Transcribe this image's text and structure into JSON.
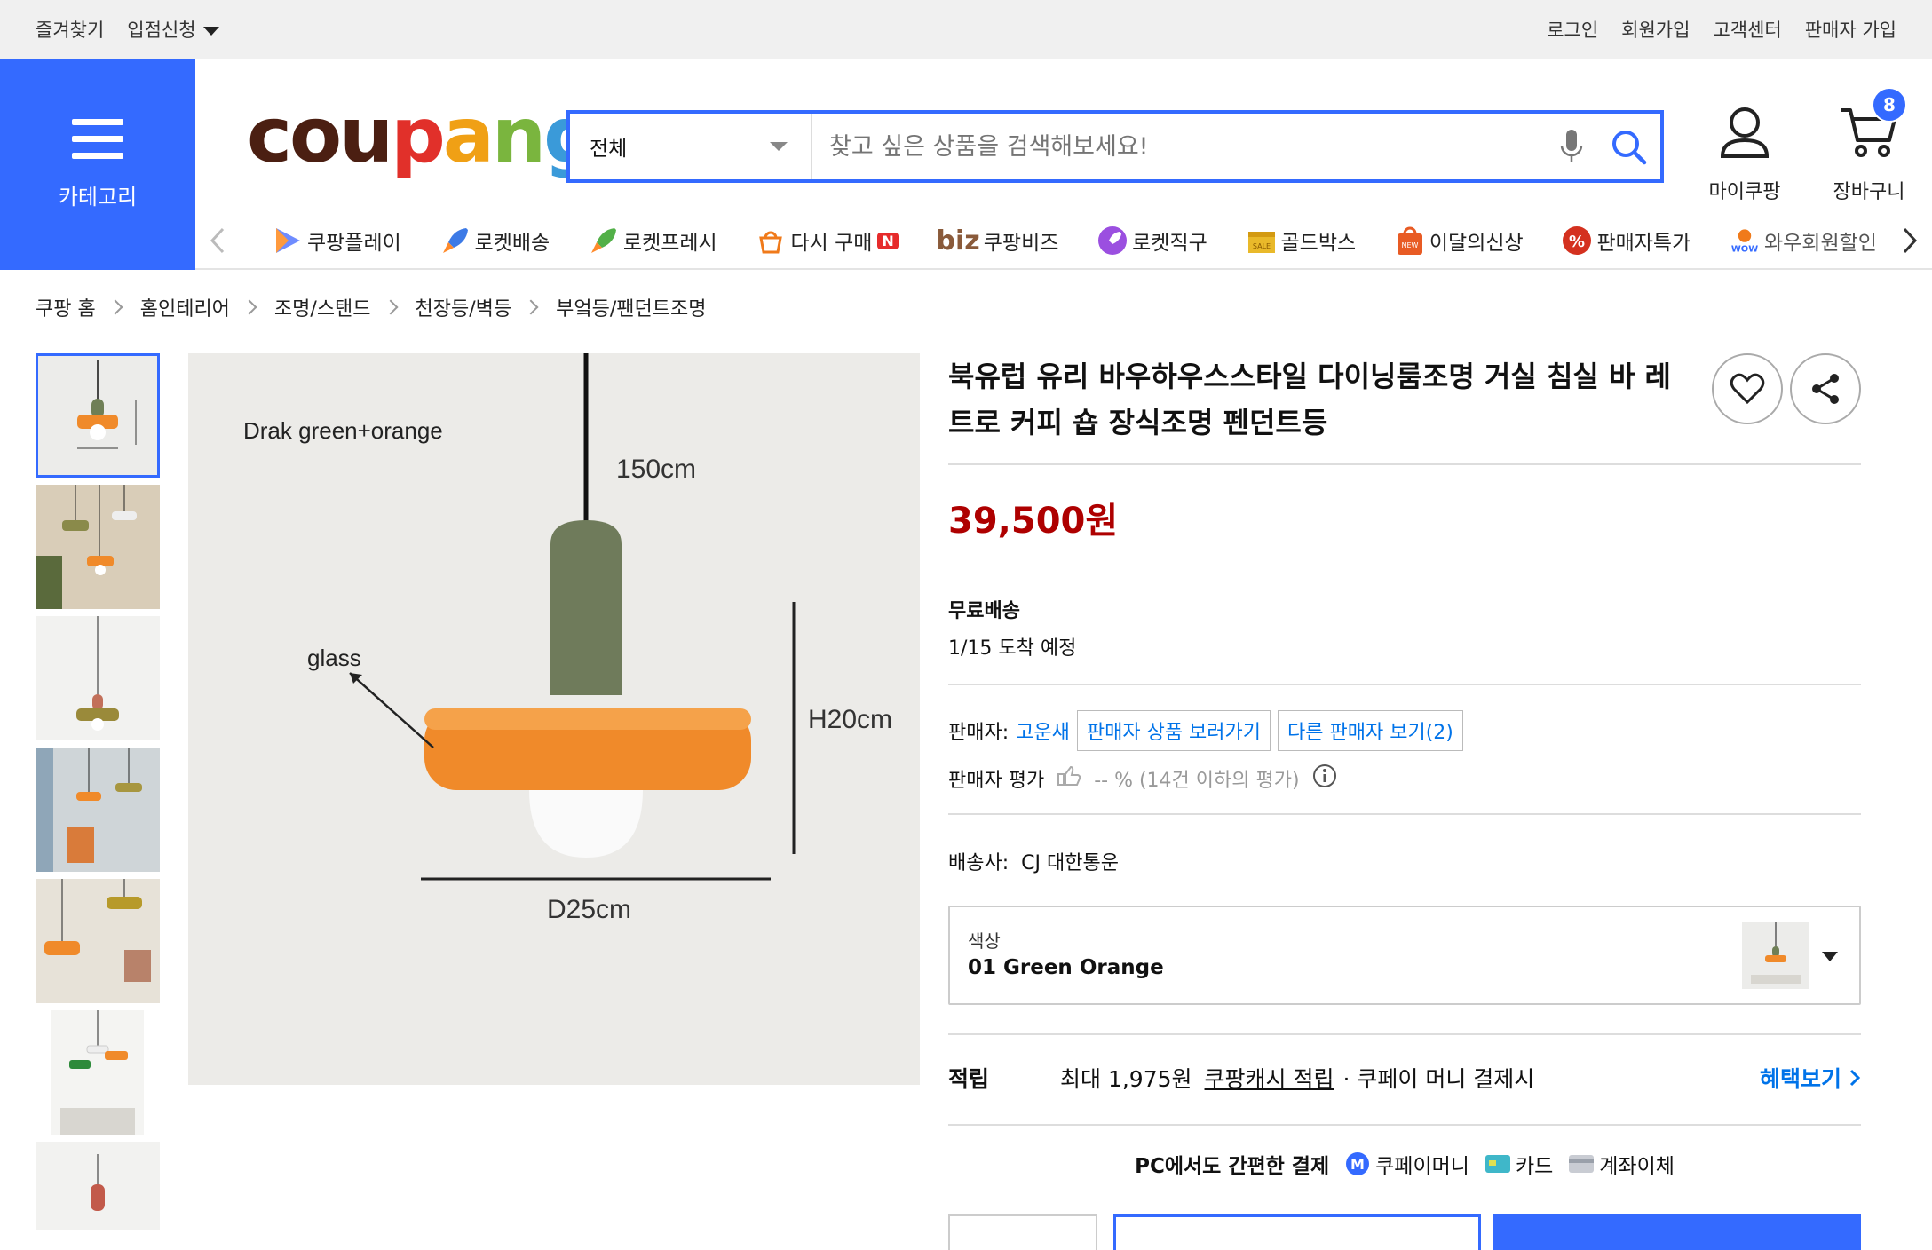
{
  "topbar": {
    "left": [
      "즐겨찾기",
      "입점신청"
    ],
    "right": [
      "로그인",
      "회원가입",
      "고객센터",
      "판매자 가입"
    ]
  },
  "header": {
    "category_label": "카테고리",
    "logo_parts": [
      "cou",
      "p",
      "a",
      "n",
      "g"
    ],
    "search": {
      "scope": "전체",
      "placeholder": "찾고 싶은 상품을 검색해보세요!"
    },
    "mycoupang_label": "마이쿠팡",
    "cart_label": "장바구니",
    "cart_count": "8"
  },
  "strip": {
    "items": [
      {
        "label": "쿠팡플레이",
        "icon": "play-icon"
      },
      {
        "label": "로켓배송",
        "icon": "rocket-blue-icon"
      },
      {
        "label": "로켓프레시",
        "icon": "rocket-green-icon"
      },
      {
        "label": "다시 구매",
        "badge": "N",
        "icon": "rebuy-icon"
      },
      {
        "label": "쿠팡비즈",
        "prefix": "biz",
        "icon": "biz-icon"
      },
      {
        "label": "로켓직구",
        "icon": "rocket-purple-icon"
      },
      {
        "label": "골드박스",
        "icon": "goldbox-icon"
      },
      {
        "label": "이달의신상",
        "icon": "new-bag-icon"
      },
      {
        "label": "판매자특가",
        "icon": "percent-icon"
      },
      {
        "label": "와우회원할인",
        "icon": "wow-icon"
      }
    ]
  },
  "breadcrumb": [
    "쿠팡 홈",
    "홈인테리어",
    "조명/스탠드",
    "천장등/벽등",
    "부엌등/팬던트조명"
  ],
  "image_labels": {
    "color_note": "Drak green+orange",
    "cable": "150cm",
    "glass": "glass",
    "height": "H20cm",
    "diameter": "D25cm"
  },
  "product": {
    "title": "북유럽 유리 바우하우스스타일 다이닝룸조명 거실 침실 바 레트로 커피 숍 장식조명 펜던트등",
    "price": "39,500원",
    "shipping_title": "무료배송",
    "arrival": "1/15 도착 예정",
    "seller_label": "판매자:",
    "seller_name": "고운새",
    "seller_products_btn": "판매자 상품 보러가기",
    "other_sellers_btn": "다른 판매자 보기(2)",
    "seller_rating_label": "판매자 평가",
    "seller_rating_value": "-- % (14건 이하의 평가)",
    "carrier_label": "배송사:",
    "carrier_name": "CJ 대한통운",
    "option_label": "색상",
    "option_value": "01 Green Orange",
    "reward_label": "적립",
    "reward_text_1": "최대 1,975원",
    "reward_link": "쿠팡캐시 적립",
    "reward_text_2": "· 쿠페이 머니 결제시",
    "benefit_link": "혜택보기",
    "pay_title": "PC에서도 간편한 결제",
    "pay_methods": [
      "쿠페이머니",
      "카드",
      "계좌이체"
    ]
  }
}
